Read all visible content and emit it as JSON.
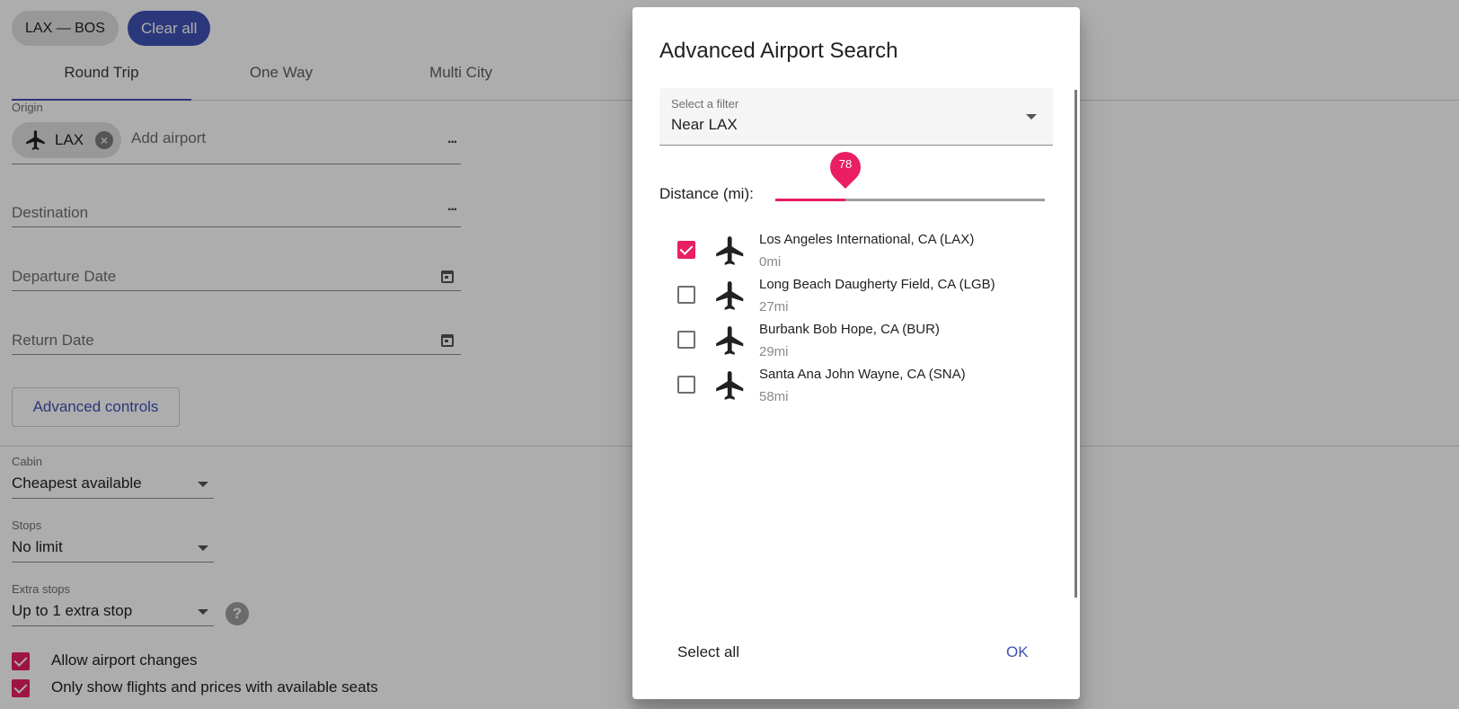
{
  "header": {
    "route_chip": "LAX — BOS",
    "clear_all": "Clear all"
  },
  "tabs": [
    "Round Trip",
    "One Way",
    "Multi City"
  ],
  "form": {
    "origin_label": "Origin",
    "origin_chip": "LAX",
    "origin_placeholder": "Add airport",
    "destination_placeholder": "Destination",
    "departure_placeholder": "Departure Date",
    "return_placeholder": "Return Date",
    "advanced_controls": "Advanced controls"
  },
  "selects": {
    "cabin": {
      "label": "Cabin",
      "value": "Cheapest available"
    },
    "stops": {
      "label": "Stops",
      "value": "No limit"
    },
    "extra_stops": {
      "label": "Extra stops",
      "value": "Up to 1 extra stop"
    }
  },
  "help_glyph": "?",
  "checkboxes": [
    {
      "label": "Allow airport changes",
      "checked": true
    },
    {
      "label": "Only show flights and prices with available seats",
      "checked": true
    }
  ],
  "dialog": {
    "title": "Advanced Airport Search",
    "filter_label": "Select a filter",
    "filter_value": "Near LAX",
    "distance_label": "Distance (mi):",
    "distance_value": "78",
    "distance_fraction": 0.26,
    "airports": [
      {
        "name": "Los Angeles International, CA (LAX)",
        "distance": "0mi",
        "checked": true
      },
      {
        "name": "Long Beach Daugherty Field, CA (LGB)",
        "distance": "27mi",
        "checked": false
      },
      {
        "name": "Burbank Bob Hope, CA (BUR)",
        "distance": "29mi",
        "checked": false
      },
      {
        "name": "Santa Ana John Wayne, CA (SNA)",
        "distance": "58mi",
        "checked": false
      }
    ],
    "select_all": "Select all",
    "ok": "OK"
  },
  "colors": {
    "accent": "#e91e63",
    "primary": "#3f51b5"
  },
  "icons": {
    "plane": "airplane-icon",
    "calendar": "calendar-icon",
    "more": "more-horiz-icon",
    "close": "close-circle-icon"
  }
}
